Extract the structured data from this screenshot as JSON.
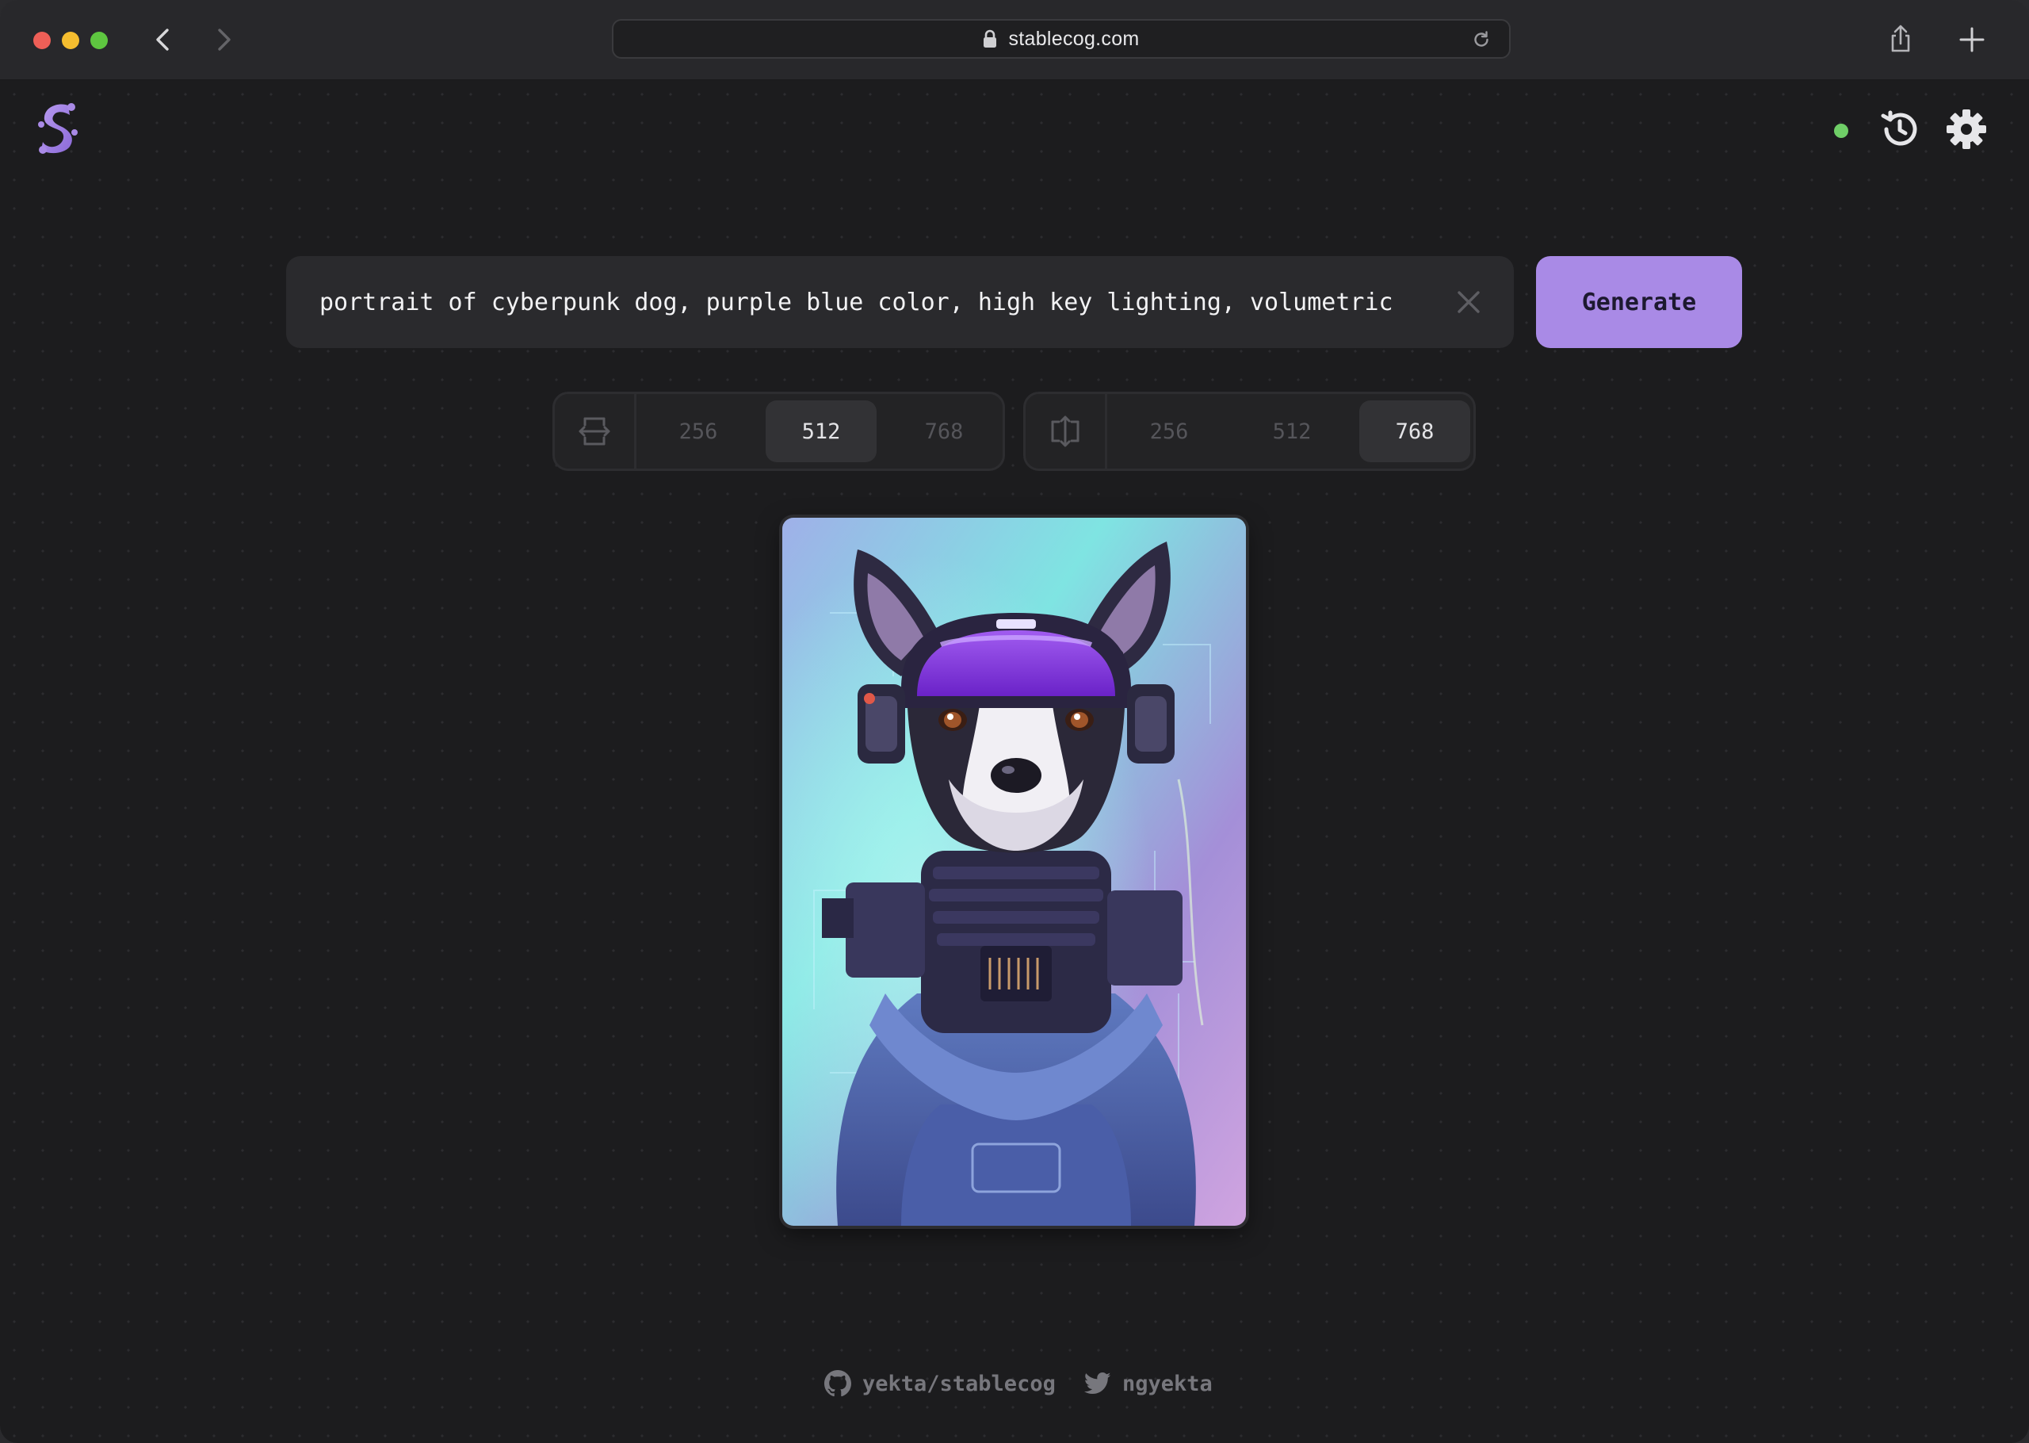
{
  "browser": {
    "url": "stablecog.com"
  },
  "prompt": {
    "value": "portrait of cyberpunk dog, purple blue color, high key lighting, volumetric"
  },
  "generate_label": "Generate",
  "width_options": [
    "256",
    "512",
    "768"
  ],
  "width_selected": "512",
  "height_options": [
    "256",
    "512",
    "768"
  ],
  "height_selected": "768",
  "image": {
    "alt": "portrait of cyberpunk dog, purple blue color, high key lighting, volumetric"
  },
  "footer": {
    "github_label": "yekta/stablecog",
    "twitter_label": "ngyekta"
  },
  "colors": {
    "accent": "#a98ae6",
    "status": "#6fce67",
    "background": "#1c1c1e"
  },
  "icons": {
    "logo": "stablecog-logo",
    "history": "history-icon",
    "settings": "gear-icon",
    "clear": "close-icon",
    "width": "width-arrows-icon",
    "height": "height-arrows-icon",
    "github": "github-icon",
    "twitter": "twitter-icon"
  }
}
